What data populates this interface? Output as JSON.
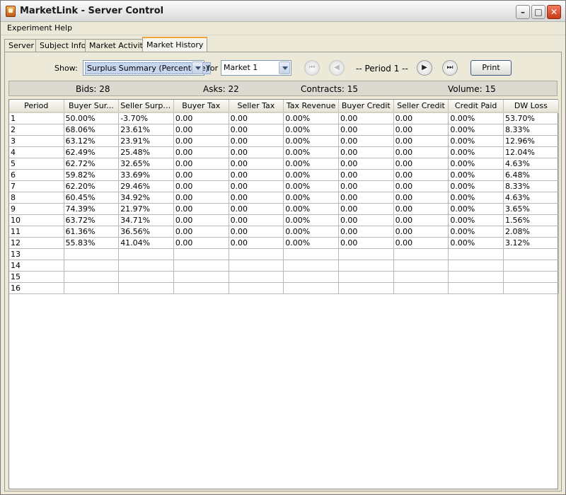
{
  "window": {
    "title": "MarketLink - Server Control"
  },
  "menu": [
    "Experiment",
    "Help"
  ],
  "tabs": [
    "Server",
    "Subject Info",
    "Market Activity",
    "Market History"
  ],
  "toolbar": {
    "show_label": "Show:",
    "show_value": "Surplus Summary (Percentage)",
    "for_label": "for",
    "market_value": "Market 1",
    "period_label": "-- Period 1 --",
    "print_label": "Print"
  },
  "stats": {
    "bids": "Bids: 28",
    "asks": "Asks: 22",
    "contracts": "Contracts: 15",
    "volume": "Volume: 15"
  },
  "table": {
    "columns": [
      "Period",
      "Buyer Sur...",
      "Seller Surplus",
      "Buyer Tax",
      "Seller Tax",
      "Tax Revenue",
      "Buyer Credit",
      "Seller Credit",
      "Credit Paid",
      "DW Loss"
    ],
    "rows": [
      [
        "1",
        "50.00%",
        "-3.70%",
        "0.00",
        "0.00",
        "0.00%",
        "0.00",
        "0.00",
        "0.00%",
        "53.70%"
      ],
      [
        "2",
        "68.06%",
        "23.61%",
        "0.00",
        "0.00",
        "0.00%",
        "0.00",
        "0.00",
        "0.00%",
        "8.33%"
      ],
      [
        "3",
        "63.12%",
        "23.91%",
        "0.00",
        "0.00",
        "0.00%",
        "0.00",
        "0.00",
        "0.00%",
        "12.96%"
      ],
      [
        "4",
        "62.49%",
        "25.48%",
        "0.00",
        "0.00",
        "0.00%",
        "0.00",
        "0.00",
        "0.00%",
        "12.04%"
      ],
      [
        "5",
        "62.72%",
        "32.65%",
        "0.00",
        "0.00",
        "0.00%",
        "0.00",
        "0.00",
        "0.00%",
        "4.63%"
      ],
      [
        "6",
        "59.82%",
        "33.69%",
        "0.00",
        "0.00",
        "0.00%",
        "0.00",
        "0.00",
        "0.00%",
        "6.48%"
      ],
      [
        "7",
        "62.20%",
        "29.46%",
        "0.00",
        "0.00",
        "0.00%",
        "0.00",
        "0.00",
        "0.00%",
        "8.33%"
      ],
      [
        "8",
        "60.45%",
        "34.92%",
        "0.00",
        "0.00",
        "0.00%",
        "0.00",
        "0.00",
        "0.00%",
        "4.63%"
      ],
      [
        "9",
        "74.39%",
        "21.97%",
        "0.00",
        "0.00",
        "0.00%",
        "0.00",
        "0.00",
        "0.00%",
        "3.65%"
      ],
      [
        "10",
        "63.72%",
        "34.71%",
        "0.00",
        "0.00",
        "0.00%",
        "0.00",
        "0.00",
        "0.00%",
        "1.56%"
      ],
      [
        "11",
        "61.36%",
        "36.56%",
        "0.00",
        "0.00",
        "0.00%",
        "0.00",
        "0.00",
        "0.00%",
        "2.08%"
      ],
      [
        "12",
        "55.83%",
        "41.04%",
        "0.00",
        "0.00",
        "0.00%",
        "0.00",
        "0.00",
        "0.00%",
        "3.12%"
      ],
      [
        "13",
        "",
        "",
        "",
        "",
        "",
        "",
        "",
        "",
        ""
      ],
      [
        "14",
        "",
        "",
        "",
        "",
        "",
        "",
        "",
        "",
        ""
      ],
      [
        "15",
        "",
        "",
        "",
        "",
        "",
        "",
        "",
        "",
        ""
      ],
      [
        "16",
        "",
        "",
        "",
        "",
        "",
        "",
        "",
        "",
        ""
      ]
    ]
  }
}
